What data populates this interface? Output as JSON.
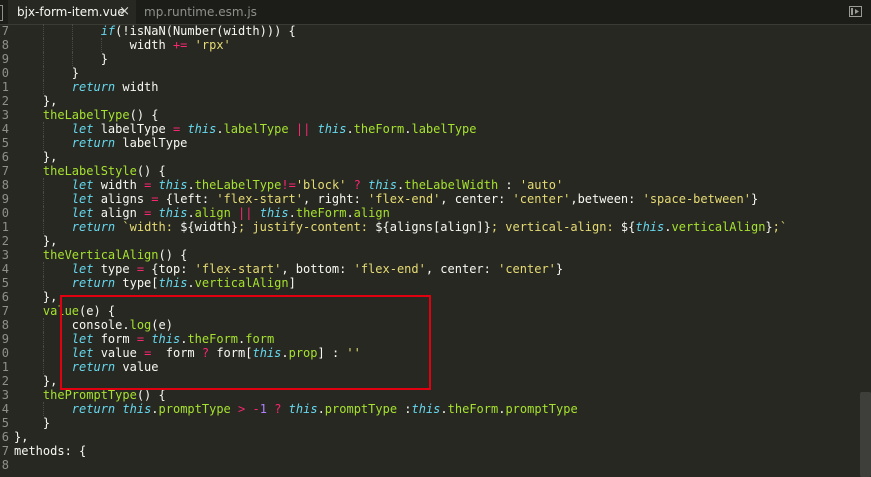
{
  "tabs": [
    {
      "label": "bjx-form-item.vue",
      "active": true,
      "close": "×"
    },
    {
      "label": "mp.runtime.esm.js",
      "active": false
    }
  ],
  "gutter_numbers": [
    "7",
    "8",
    "9",
    "0",
    "1",
    "2",
    "3",
    "4",
    "5",
    "6",
    "7",
    "8",
    "9",
    "0",
    "1",
    "2",
    "3",
    "4",
    "5",
    "6",
    "7",
    "8",
    "9",
    "0",
    "1",
    "2",
    "3",
    "4",
    "5",
    "6",
    "7",
    "8"
  ],
  "colors": {
    "background": "#272822",
    "keyword": "#66d9ef",
    "function": "#a6e22e",
    "operator": "#f92672",
    "string": "#e6db74",
    "highlight_box": "#e0000f"
  },
  "code_lines": [
    [
      [
        "pl",
        "            "
      ],
      [
        "kw",
        "if"
      ],
      [
        "pl",
        "(!isNaN(Number(width))) {"
      ]
    ],
    [
      [
        "pl",
        "                width "
      ],
      [
        "op",
        "+="
      ],
      [
        "pl",
        " "
      ],
      [
        "str",
        "'rpx'"
      ]
    ],
    [
      [
        "pl",
        "            }"
      ]
    ],
    [
      [
        "pl",
        "        }"
      ]
    ],
    [
      [
        "pl",
        "        "
      ],
      [
        "kw",
        "return"
      ],
      [
        "pl",
        " width"
      ]
    ],
    [
      [
        "pl",
        "    },"
      ]
    ],
    [
      [
        "pl",
        "    "
      ],
      [
        "fn",
        "theLabelType"
      ],
      [
        "pl",
        "() {"
      ]
    ],
    [
      [
        "pl",
        "        "
      ],
      [
        "kw",
        "let"
      ],
      [
        "pl",
        " labelType "
      ],
      [
        "op",
        "="
      ],
      [
        "pl",
        " "
      ],
      [
        "this",
        "this"
      ],
      [
        "pl",
        "."
      ],
      [
        "fn",
        "labelType"
      ],
      [
        "pl",
        " "
      ],
      [
        "op",
        "||"
      ],
      [
        "pl",
        " "
      ],
      [
        "this",
        "this"
      ],
      [
        "pl",
        "."
      ],
      [
        "fn",
        "theForm"
      ],
      [
        "pl",
        "."
      ],
      [
        "fn",
        "labelType"
      ]
    ],
    [
      [
        "pl",
        "        "
      ],
      [
        "kw",
        "return"
      ],
      [
        "pl",
        " labelType"
      ]
    ],
    [
      [
        "pl",
        "    },"
      ]
    ],
    [
      [
        "pl",
        "    "
      ],
      [
        "fn",
        "theLabelStyle"
      ],
      [
        "pl",
        "() {"
      ]
    ],
    [
      [
        "pl",
        "        "
      ],
      [
        "kw",
        "let"
      ],
      [
        "pl",
        " width "
      ],
      [
        "op",
        "="
      ],
      [
        "pl",
        " "
      ],
      [
        "this",
        "this"
      ],
      [
        "pl",
        "."
      ],
      [
        "fn",
        "theLabelType"
      ],
      [
        "op",
        "!="
      ],
      [
        "str",
        "'block'"
      ],
      [
        "pl",
        " "
      ],
      [
        "op",
        "?"
      ],
      [
        "pl",
        " "
      ],
      [
        "this",
        "this"
      ],
      [
        "pl",
        "."
      ],
      [
        "fn",
        "theLabelWidth"
      ],
      [
        "pl",
        " : "
      ],
      [
        "str",
        "'auto'"
      ]
    ],
    [
      [
        "pl",
        "        "
      ],
      [
        "kw",
        "let"
      ],
      [
        "pl",
        " aligns "
      ],
      [
        "op",
        "="
      ],
      [
        "pl",
        " {left: "
      ],
      [
        "str",
        "'flex-start'"
      ],
      [
        "pl",
        ", right: "
      ],
      [
        "str",
        "'flex-end'"
      ],
      [
        "pl",
        ", center: "
      ],
      [
        "str",
        "'center'"
      ],
      [
        "pl",
        ",between: "
      ],
      [
        "str",
        "'space-between'"
      ],
      [
        "pl",
        "}"
      ]
    ],
    [
      [
        "pl",
        "        "
      ],
      [
        "kw",
        "let"
      ],
      [
        "pl",
        " align "
      ],
      [
        "op",
        "="
      ],
      [
        "pl",
        " "
      ],
      [
        "this",
        "this"
      ],
      [
        "pl",
        "."
      ],
      [
        "fn",
        "align"
      ],
      [
        "pl",
        " "
      ],
      [
        "op",
        "||"
      ],
      [
        "pl",
        " "
      ],
      [
        "this",
        "this"
      ],
      [
        "pl",
        "."
      ],
      [
        "fn",
        "theForm"
      ],
      [
        "pl",
        "."
      ],
      [
        "fn",
        "align"
      ]
    ],
    [
      [
        "pl",
        "        "
      ],
      [
        "kw",
        "return"
      ],
      [
        "pl",
        " "
      ],
      [
        "str",
        "`width: "
      ],
      [
        "pl",
        "${width}"
      ],
      [
        "str",
        "; justify-content: "
      ],
      [
        "pl",
        "${aligns[align]}"
      ],
      [
        "str",
        "; vertical-align: "
      ],
      [
        "pl",
        "${"
      ],
      [
        "this",
        "this"
      ],
      [
        "pl",
        "."
      ],
      [
        "fn",
        "verticalAlign"
      ],
      [
        "pl",
        "}"
      ],
      [
        "str",
        ";`"
      ]
    ],
    [
      [
        "pl",
        "    },"
      ]
    ],
    [
      [
        "pl",
        "    "
      ],
      [
        "fn",
        "theVerticalAlign"
      ],
      [
        "pl",
        "() {"
      ]
    ],
    [
      [
        "pl",
        "        "
      ],
      [
        "kw",
        "let"
      ],
      [
        "pl",
        " type "
      ],
      [
        "op",
        "="
      ],
      [
        "pl",
        " {top: "
      ],
      [
        "str",
        "'flex-start'"
      ],
      [
        "pl",
        ", bottom: "
      ],
      [
        "str",
        "'flex-end'"
      ],
      [
        "pl",
        ", center: "
      ],
      [
        "str",
        "'center'"
      ],
      [
        "pl",
        "}"
      ]
    ],
    [
      [
        "pl",
        "        "
      ],
      [
        "kw",
        "return"
      ],
      [
        "pl",
        " type["
      ],
      [
        "this",
        "this"
      ],
      [
        "pl",
        "."
      ],
      [
        "fn",
        "verticalAlign"
      ],
      [
        "pl",
        "]"
      ]
    ],
    [
      [
        "pl",
        "    },"
      ]
    ],
    [
      [
        "pl",
        "    "
      ],
      [
        "fn",
        "value"
      ],
      [
        "pl",
        "(e) {"
      ]
    ],
    [
      [
        "pl",
        "        console."
      ],
      [
        "fn",
        "log"
      ],
      [
        "pl",
        "(e)"
      ]
    ],
    [
      [
        "pl",
        "        "
      ],
      [
        "kw",
        "let"
      ],
      [
        "pl",
        " form "
      ],
      [
        "op",
        "="
      ],
      [
        "pl",
        " "
      ],
      [
        "this",
        "this"
      ],
      [
        "pl",
        "."
      ],
      [
        "fn",
        "theForm"
      ],
      [
        "pl",
        "."
      ],
      [
        "fn",
        "form"
      ]
    ],
    [
      [
        "pl",
        "        "
      ],
      [
        "kw",
        "let"
      ],
      [
        "pl",
        " value "
      ],
      [
        "op",
        "="
      ],
      [
        "pl",
        "  form "
      ],
      [
        "op",
        "?"
      ],
      [
        "pl",
        " form["
      ],
      [
        "this",
        "this"
      ],
      [
        "pl",
        "."
      ],
      [
        "fn",
        "prop"
      ],
      [
        "pl",
        "] : "
      ],
      [
        "str",
        "''"
      ]
    ],
    [
      [
        "pl",
        "        "
      ],
      [
        "kw",
        "return"
      ],
      [
        "pl",
        " value"
      ]
    ],
    [
      [
        "pl",
        "    },"
      ]
    ],
    [
      [
        "pl",
        "    "
      ],
      [
        "fn",
        "thePromptType"
      ],
      [
        "pl",
        "() {"
      ]
    ],
    [
      [
        "pl",
        "        "
      ],
      [
        "kw",
        "return"
      ],
      [
        "pl",
        " "
      ],
      [
        "this",
        "this"
      ],
      [
        "pl",
        "."
      ],
      [
        "fn",
        "promptType"
      ],
      [
        "pl",
        " "
      ],
      [
        "op",
        ">"
      ],
      [
        "pl",
        " "
      ],
      [
        "op",
        "-"
      ],
      [
        "num",
        "1"
      ],
      [
        "pl",
        " "
      ],
      [
        "op",
        "?"
      ],
      [
        "pl",
        " "
      ],
      [
        "this",
        "this"
      ],
      [
        "pl",
        "."
      ],
      [
        "fn",
        "promptType"
      ],
      [
        "pl",
        " :"
      ],
      [
        "this",
        "this"
      ],
      [
        "pl",
        "."
      ],
      [
        "fn",
        "theForm"
      ],
      [
        "pl",
        "."
      ],
      [
        "fn",
        "promptType"
      ]
    ],
    [
      [
        "pl",
        "    }"
      ]
    ],
    [
      [
        "pl",
        "},"
      ]
    ],
    [
      [
        "pl",
        "methods: {"
      ]
    ],
    [
      [
        "pl",
        ""
      ]
    ]
  ]
}
